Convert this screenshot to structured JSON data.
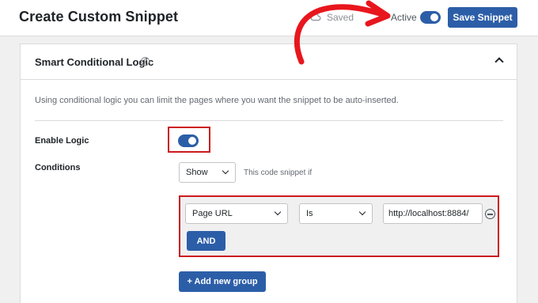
{
  "header": {
    "title": "Create Custom Snippet",
    "saved_status": "Saved",
    "active_label": "Active",
    "active_toggle_on": true,
    "save_button": "Save Snippet"
  },
  "section": {
    "title": "Smart Conditional Logic",
    "help_icon": "?",
    "description": "Using conditional logic you can limit the pages where you want the snippet to be auto-inserted.",
    "enable_logic_label": "Enable Logic",
    "enable_logic_on": true,
    "conditions_label": "Conditions",
    "show_select": "Show",
    "snippet_if_text": "This code snippet if",
    "rule": {
      "field": "Page URL",
      "operator": "Is",
      "value": "http://localhost:8884/"
    },
    "and_button": "AND",
    "add_group_button": "+ Add new group"
  },
  "colors": {
    "accent": "#2c5ea8",
    "highlight": "#cc1a1f",
    "annotation_arrow": "#e8161d"
  },
  "icons": [
    "cloud-icon",
    "help-icon",
    "chevron-up-icon",
    "chevron-down-icon",
    "remove-circle-icon",
    "annotation-arrow"
  ]
}
